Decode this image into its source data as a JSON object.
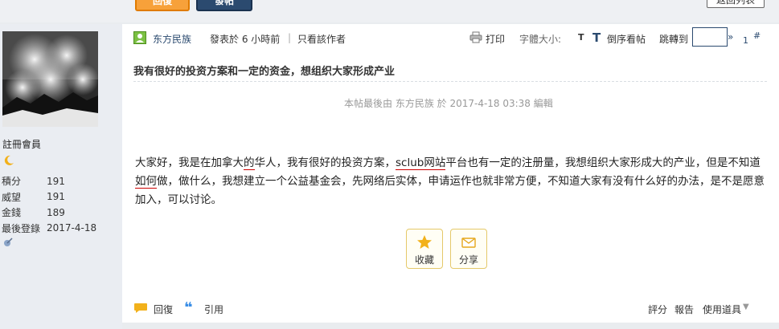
{
  "top": {
    "reply_button": "回復",
    "post_button": "發帖",
    "back_button": "返回列表"
  },
  "sidebar": {
    "group": "註冊會員",
    "stats": [
      {
        "label": "積分",
        "value": "191"
      },
      {
        "label": "威望",
        "value": "191"
      },
      {
        "label": "金錢",
        "value": "189"
      },
      {
        "label": "最後登錄",
        "value": "2017-4-18"
      }
    ]
  },
  "post": {
    "author": "东方民族",
    "posted_prefix": "發表於",
    "posted_time": "6 小時前",
    "separator": "|",
    "only_author": "只看該作者",
    "print": "打印",
    "font_size_label": "字體大小:",
    "font_size_t": "T",
    "sort_t": "T",
    "sort_label": "倒序看帖",
    "jump_label": "跳轉到",
    "jump_arrow": "»",
    "floor_number": "1",
    "floor_hash": "#",
    "title": "我有很好的投资方案和一定的资金，想组织大家形成产业",
    "edited_note": "本帖最後由 东方民族 於 2017-4-18 03:38 編輯",
    "body": {
      "s1": "大家好，我是在加拿大",
      "u1": "的",
      "s2": "华人，我有很好的投资方案，",
      "u2": "sclub网站",
      "s3": "平台也有一定的注册量，我想组织大家形成大的产业，但是不知道",
      "u3": "如何",
      "s4": "做，做什么，我想建立一个公益基金会，先网络后实体，申请运作也就非常方便，不知道大家有没有什么好的办法，是不是愿意加入，可以讨论。"
    },
    "favorite_label": "收藏",
    "share_label": "分享",
    "reply_label": "回復",
    "quote_label": "引用",
    "rate_label": "評分",
    "report_label": "報告",
    "tools_label": "使用道具",
    "tools_caret": "▼"
  },
  "colors": {
    "accent_navy": "#2b4a6f",
    "reply_orange": "#f7a13a",
    "sidebar_bg": "#eaedf2",
    "action_border": "#e5c96a"
  }
}
